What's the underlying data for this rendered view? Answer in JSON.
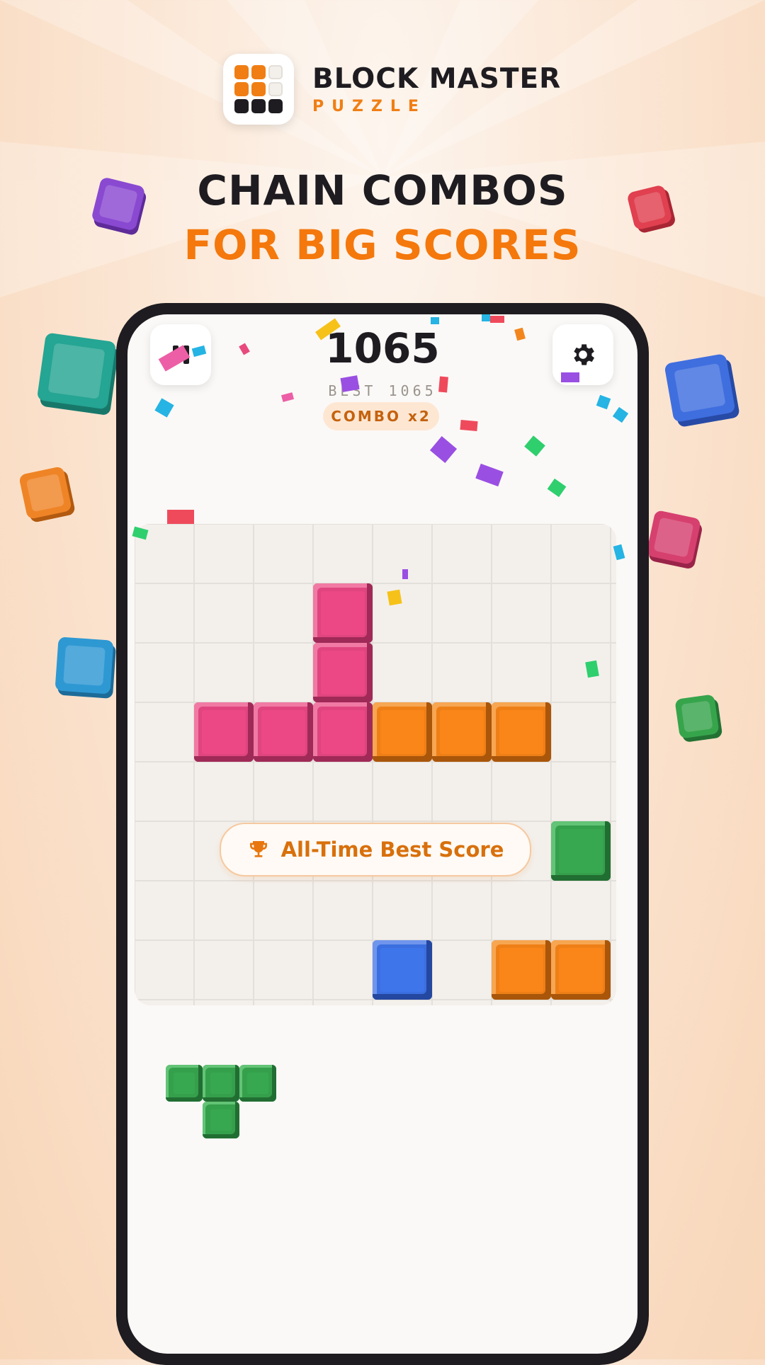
{
  "logo": {
    "title": "BLOCK MASTER",
    "subtitle": "PUZZLE"
  },
  "headline": {
    "line1": "CHAIN COMBOS",
    "line2": "FOR BIG SCORES"
  },
  "hud": {
    "score": "1065",
    "best": "BEST 1065",
    "combo": "COMBO x2"
  },
  "banner": {
    "text": "All-Time Best Score",
    "icon": "trophy-icon"
  },
  "board": {
    "rows": 8,
    "cols": 8
  },
  "colors": {
    "accent": "#f4780c",
    "pink": "#e0457f",
    "orange": "#ee7f17",
    "blue": "#3b6fe0",
    "green": "#35a04c",
    "dark": "#1e1c20"
  },
  "icons": [
    "pause-icon",
    "gear-icon",
    "trophy-icon"
  ]
}
